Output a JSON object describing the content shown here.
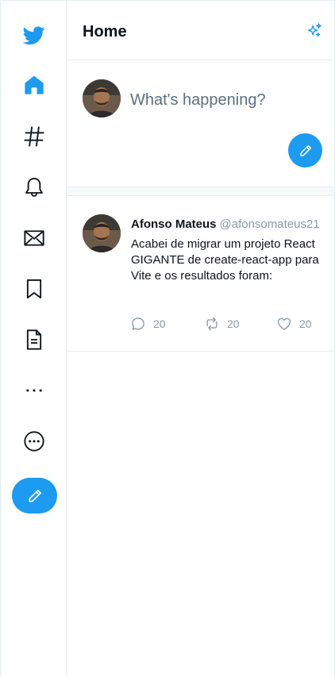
{
  "header": {
    "title": "Home"
  },
  "composer": {
    "placeholder": "What's happening?"
  },
  "tweet": {
    "author_name": "Afonso Mateus",
    "author_handle": "@afonsomateus21",
    "text": "Acabei de migrar um projeto React GIGANTE de create-react-app para Vite e os resultados foram:",
    "replies": "20",
    "retweets": "20",
    "likes": "20"
  },
  "sidebar": {
    "items": [
      {
        "icon": "twitter-logo-icon"
      },
      {
        "icon": "home-icon"
      },
      {
        "icon": "hashtag-icon"
      },
      {
        "icon": "bell-icon"
      },
      {
        "icon": "envelope-icon"
      },
      {
        "icon": "bookmark-icon"
      },
      {
        "icon": "document-icon"
      },
      {
        "icon": "more-dots-icon"
      },
      {
        "icon": "more-circle-icon"
      }
    ]
  },
  "colors": {
    "accent": "#1d9bf0",
    "text": "#0f1419",
    "muted": "#8899a6",
    "border": "#e6ecf0"
  }
}
